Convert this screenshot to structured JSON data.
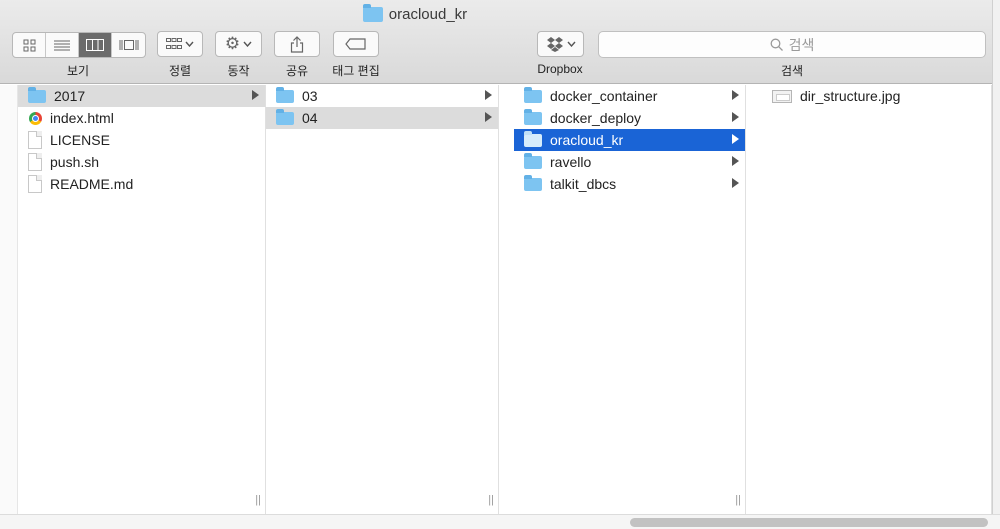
{
  "window": {
    "title": "oracloud_kr"
  },
  "toolbar": {
    "view_label": "보기",
    "arrange_label": "정렬",
    "action_label": "동작",
    "share_label": "공유",
    "tags_label": "태그 편집",
    "dropbox_label": "Dropbox",
    "search_label": "검색",
    "search_placeholder": "검색"
  },
  "columns": [
    {
      "items": [
        {
          "name": "2017",
          "type": "folder",
          "has_children": true,
          "selected": "grey"
        },
        {
          "name": "index.html",
          "type": "html"
        },
        {
          "name": "LICENSE",
          "type": "file"
        },
        {
          "name": "push.sh",
          "type": "file"
        },
        {
          "name": "README.md",
          "type": "file"
        }
      ]
    },
    {
      "items": [
        {
          "name": "03",
          "type": "folder",
          "has_children": true
        },
        {
          "name": "04",
          "type": "folder",
          "has_children": true,
          "selected": "grey"
        }
      ]
    },
    {
      "items": [
        {
          "name": "docker_container",
          "type": "folder",
          "has_children": true
        },
        {
          "name": "docker_deploy",
          "type": "folder",
          "has_children": true
        },
        {
          "name": "oracloud_kr",
          "type": "folder",
          "has_children": true,
          "selected": "blue"
        },
        {
          "name": "ravello",
          "type": "folder",
          "has_children": true
        },
        {
          "name": "talkit_dbcs",
          "type": "folder",
          "has_children": true
        }
      ]
    },
    {
      "items": [
        {
          "name": "dir_structure.jpg",
          "type": "image"
        }
      ]
    }
  ],
  "colors": {
    "selection_blue": "#1a64d6",
    "selection_grey": "#dcdcdc",
    "folder": "#7dc4f1"
  }
}
